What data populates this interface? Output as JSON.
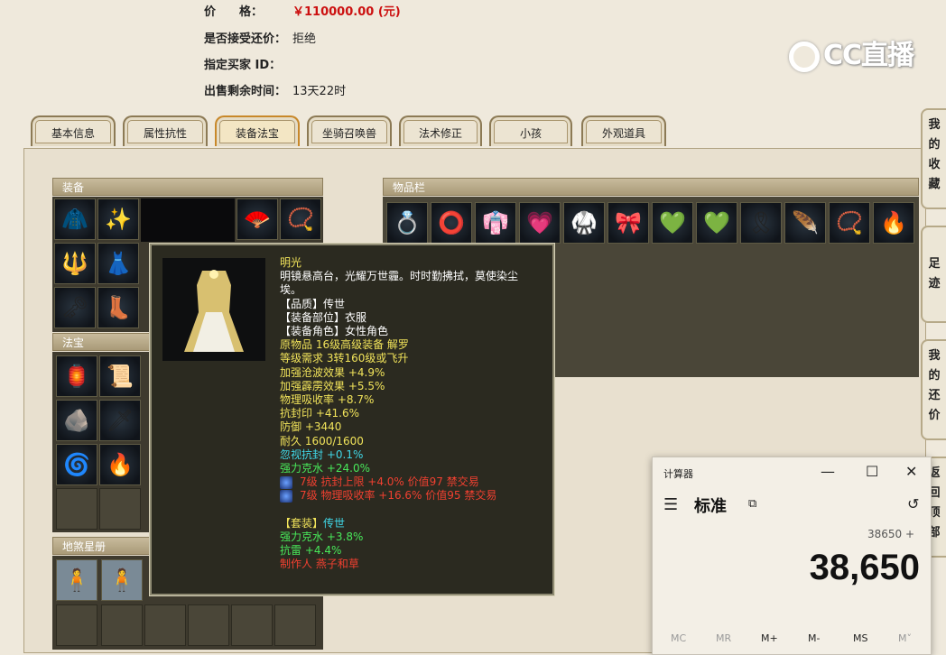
{
  "header": {
    "price_label": "价　　格：",
    "price_value": "￥110000.00 (元)",
    "bargain_label": "是否接受还价：",
    "bargain_value": "拒绝",
    "buyer_label": "指定买家 ID：",
    "buyer_value": "",
    "time_label": "出售剩余时间：",
    "time_value": "13天22时"
  },
  "logo": "CC直播",
  "tabs": [
    {
      "label": "基本信息"
    },
    {
      "label": "属性抗性"
    },
    {
      "label": "装备法宝"
    },
    {
      "label": "坐骑召唤兽"
    },
    {
      "label": "法术修正"
    },
    {
      "label": "小孩"
    },
    {
      "label": "外观道具"
    }
  ],
  "sections": {
    "equipment": "装备",
    "treasure": "法宝",
    "star": "地煞星册",
    "inventory": "物品栏"
  },
  "tooltip": {
    "name": "明光",
    "desc1": "明镜悬高台，光耀万世霾。时时勤拂拭，莫使染尘",
    "desc2": "埃。",
    "quality": "【品质】传世",
    "slot": "【装备部位】衣服",
    "role": "【装备角色】女性角色",
    "origin": "原物品 16级高级装备 解罗",
    "req": "等级需求 3转160级或飞升",
    "attr1": "加强沧波效果 +4.9%",
    "attr2": "加强霹雳效果 +5.5%",
    "attr3": "物理吸收率 +8.7%",
    "attr4": "抗封印 +41.6%",
    "attr5": "防御 +3440",
    "attr6": "耐久 1600/1600",
    "attr7": "忽视抗封 +0.1%",
    "attr8": "强力克水 +24.0%",
    "gem1": "7级 抗封上限 +4.0% 价值97 禁交易",
    "gem2": "7级 物理吸收率 +16.6% 价值95 禁交易",
    "set_label": "【套装】",
    "set_value": "传世",
    "set1": "强力克水 +3.8%",
    "set2": "抗雷 +4.4%",
    "maker": "制作人 燕子和草"
  },
  "side_buttons": [
    {
      "label": "我的收藏"
    },
    {
      "label": "足迹"
    },
    {
      "label": "我的还价"
    },
    {
      "label": "返回顶部"
    }
  ],
  "calculator": {
    "title": "计算器",
    "mode": "标准",
    "expression": "38650 +",
    "result": "38,650",
    "mem_buttons": [
      "MC",
      "MR",
      "M+",
      "M-",
      "MS",
      "M˅"
    ]
  }
}
